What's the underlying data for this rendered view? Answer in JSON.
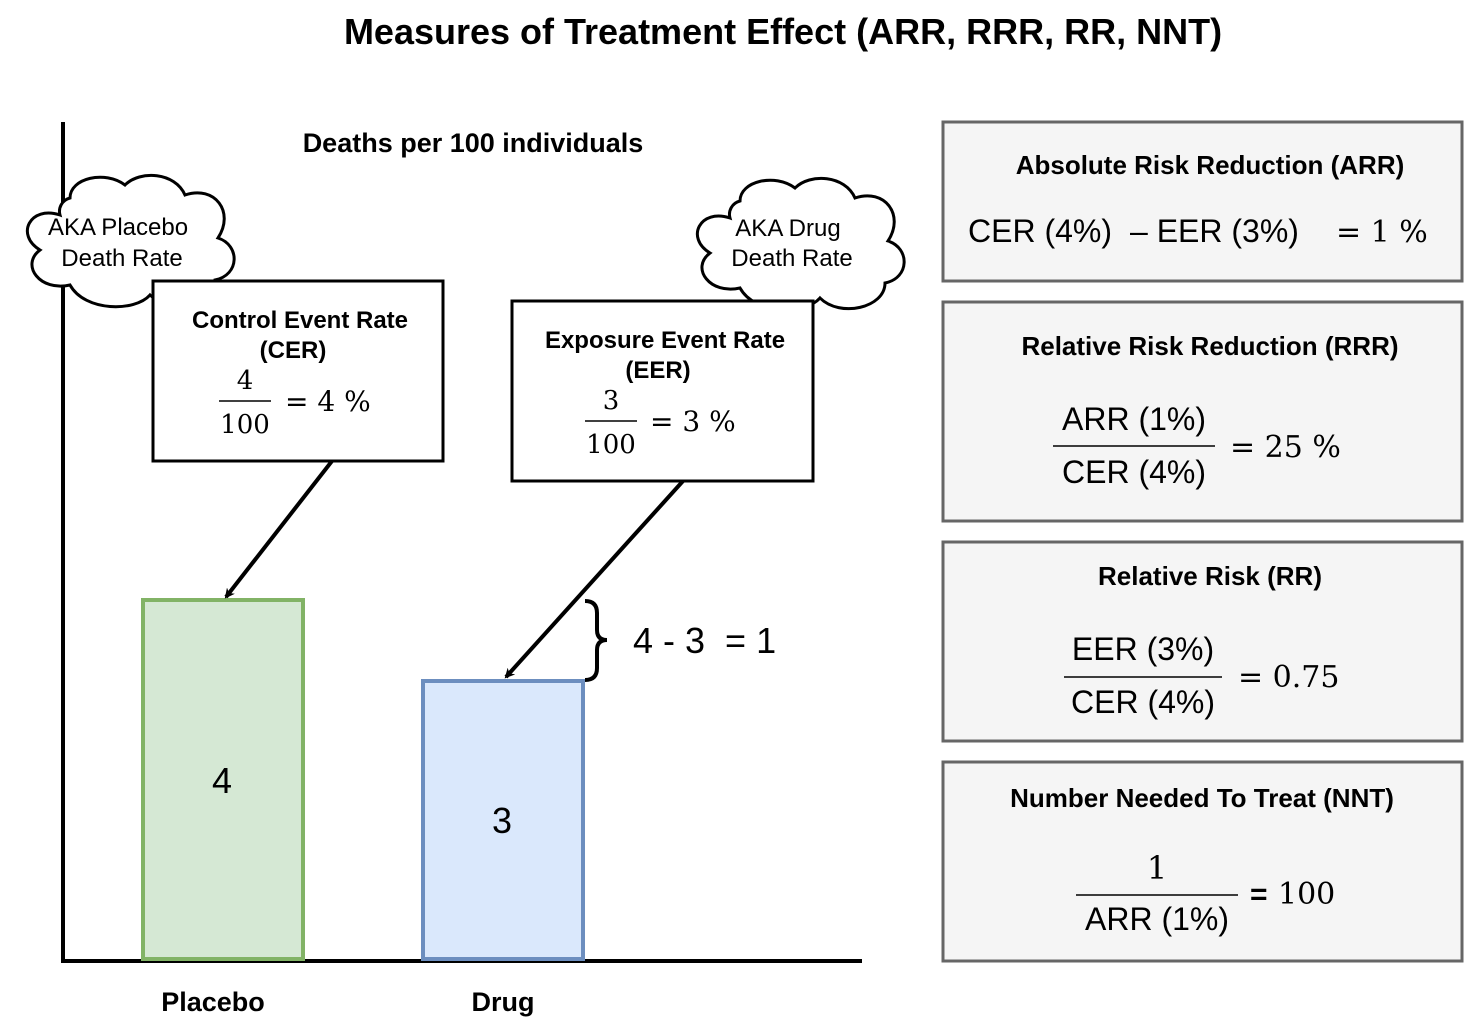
{
  "title": "Measures of Treatment Effect (ARR, RRR, RR, NNT)",
  "chart": {
    "subtitle": "Deaths per 100 individuals",
    "bars": [
      {
        "label": "Placebo",
        "value": "4",
        "fill": "#d5e8d4",
        "stroke": "#82b366"
      },
      {
        "label": "Drug",
        "value": "3",
        "fill": "#dae8fc",
        "stroke": "#6c8ebf"
      }
    ],
    "difference": "4 - 3  = 1"
  },
  "clouds": {
    "placebo": [
      "AKA Placebo",
      "Death Rate"
    ],
    "drug": [
      "AKA Drug",
      "Death Rate"
    ]
  },
  "cer_box": {
    "title": [
      "Control Event Rate",
      "(CER)"
    ],
    "numerator": "4",
    "denominator": "100",
    "result": "= 4 %"
  },
  "eer_box": {
    "title": [
      "Exposure Event Rate",
      "(EER)"
    ],
    "numerator": "3",
    "denominator": "100",
    "result": "= 3 %"
  },
  "measures": [
    {
      "title": "Absolute Risk Reduction (ARR)",
      "formula": [
        "CER (4%)",
        "– EER (3%)",
        "= 1 %"
      ]
    },
    {
      "title": "Relative Risk Reduction (RRR)",
      "numerator": "ARR (1%)",
      "denominator": "CER (4%)",
      "result": "= 25 %"
    },
    {
      "title": "Relative Risk (RR)",
      "numerator": "EER (3%)",
      "denominator": "CER (4%)",
      "result": "= 0.75"
    },
    {
      "title": "Number Needed To Treat (NNT)",
      "numerator": "1",
      "denominator": "ARR (1%)",
      "result_eq": "=",
      "result": "100"
    }
  ],
  "colors": {
    "panel_fill": "#f5f5f5",
    "panel_stroke": "#666666"
  }
}
